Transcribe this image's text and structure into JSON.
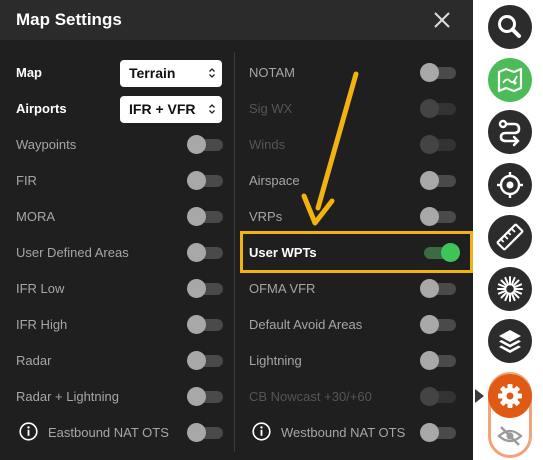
{
  "panel": {
    "title": "Map Settings"
  },
  "left_column": [
    {
      "label": "Map",
      "type": "select",
      "value": "Terrain",
      "bold": true
    },
    {
      "label": "Airports",
      "type": "select",
      "value": "IFR + VFR",
      "bold": true
    },
    {
      "label": "Waypoints",
      "type": "toggle",
      "state": "off"
    },
    {
      "label": "FIR",
      "type": "toggle",
      "state": "off"
    },
    {
      "label": "MORA",
      "type": "toggle",
      "state": "off"
    },
    {
      "label": "User Defined Areas",
      "type": "toggle",
      "state": "off"
    },
    {
      "label": "IFR Low",
      "type": "toggle",
      "state": "off"
    },
    {
      "label": "IFR High",
      "type": "toggle",
      "state": "off"
    },
    {
      "label": "Radar",
      "type": "toggle",
      "state": "off"
    },
    {
      "label": "Radar + Lightning",
      "type": "toggle",
      "state": "off"
    },
    {
      "label": "Eastbound NAT OTS",
      "type": "toggle",
      "state": "off",
      "info_icon": "info-icon"
    }
  ],
  "right_column": [
    {
      "label": "NOTAM",
      "type": "toggle",
      "state": "off"
    },
    {
      "label": "Sig WX",
      "type": "toggle",
      "state": "disabled"
    },
    {
      "label": "Winds",
      "type": "toggle",
      "state": "disabled"
    },
    {
      "label": "Airspace",
      "type": "toggle",
      "state": "off"
    },
    {
      "label": "VRPs",
      "type": "toggle",
      "state": "off"
    },
    {
      "label": "User WPTs",
      "type": "toggle",
      "state": "on",
      "bold": true,
      "highlighted": true
    },
    {
      "label": "OFMA VFR",
      "type": "toggle",
      "state": "off"
    },
    {
      "label": "Default Avoid Areas",
      "type": "toggle",
      "state": "off"
    },
    {
      "label": "Lightning",
      "type": "toggle",
      "state": "off"
    },
    {
      "label": "CB Nowcast +30/+60",
      "type": "toggle",
      "state": "disabled"
    },
    {
      "label": "Westbound NAT OTS",
      "type": "toggle",
      "state": "off",
      "info_icon": "info-icon"
    }
  ],
  "toolbar": {
    "buttons": [
      "search-icon",
      "map-icon",
      "route-icon",
      "locate-icon",
      "ruler-icon",
      "starburst-icon",
      "layers-icon",
      "gear-icon",
      "hide-eye-icon"
    ]
  },
  "colors": {
    "panel_bg": "#1f1f1f",
    "header_bg": "#2b2b2b",
    "toggle_on": "#3fc45a",
    "highlight": "#f2b311",
    "active_tool": "#e05a14",
    "map_tool": "#4dbb58"
  }
}
